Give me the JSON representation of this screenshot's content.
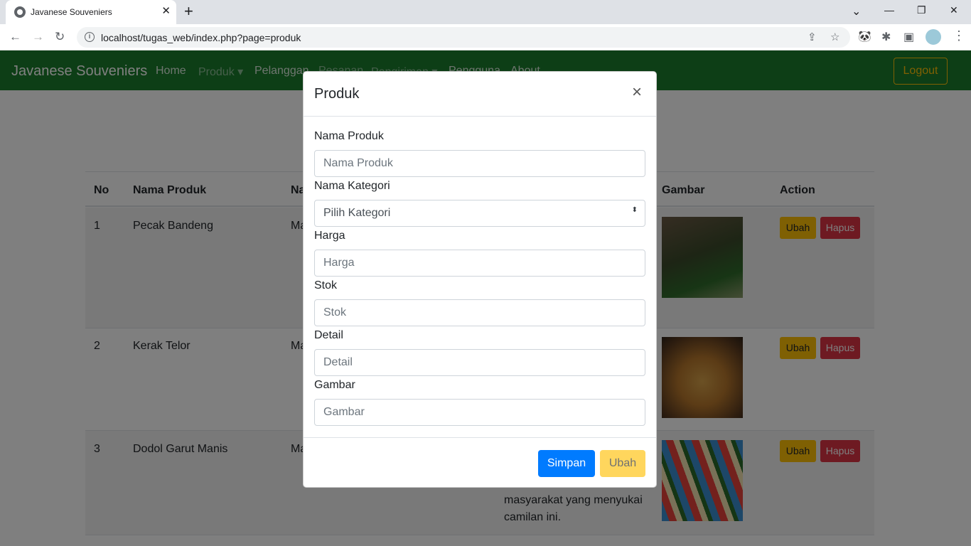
{
  "browser": {
    "tab_title": "Javanese Souveniers",
    "tab_close": "✕",
    "new_tab": "+",
    "url": "localhost/tugas_web/index.php?page=produk",
    "info_glyph": "i",
    "window_controls": {
      "chevron": "⌄",
      "minimize": "—",
      "restore": "❐",
      "close": "✕"
    },
    "nav": {
      "back": "←",
      "forward": "→",
      "reload": "↻"
    },
    "omni_icons": {
      "share": "⇪",
      "star": "☆"
    },
    "extensions": {
      "panda": "🐼",
      "puzzle": "✱",
      "sidepanel": "▣",
      "menu": "⋮"
    }
  },
  "navbar": {
    "brand": "Javanese Souveniers",
    "links": [
      "Home",
      "Produk ▾",
      "Pelanggan",
      "Pesanan",
      "Pengiriman ▾",
      "Pengguna",
      "About"
    ],
    "logout": "Logout"
  },
  "table": {
    "headers": [
      "No",
      "Nama Produk",
      "Na",
      "Gambar",
      "Action"
    ],
    "rows": [
      {
        "no": "1",
        "name": "Pecak Bandeng",
        "kategori": "Ma"
      },
      {
        "no": "2",
        "name": "Kerak Telor",
        "kategori": "Ma"
      },
      {
        "no": "3",
        "name": "Dodol Garut Manis",
        "kategori": "Ma"
      }
    ],
    "desc_lines": [
      "masyarakat yang menyukai",
      "camilan ini."
    ],
    "action_ubah": "Ubah",
    "action_hapus": "Hapus"
  },
  "modal": {
    "title": "Produk",
    "close": "×",
    "fields": {
      "nama_produk": {
        "label": "Nama Produk",
        "placeholder": "Nama Produk"
      },
      "kategori": {
        "label": "Nama Kategori",
        "value": "Pilih Kategori",
        "arrow": "⬍"
      },
      "harga": {
        "label": "Harga",
        "placeholder": "Harga"
      },
      "stok": {
        "label": "Stok",
        "placeholder": "Stok"
      },
      "detail": {
        "label": "Detail",
        "placeholder": "Detail"
      },
      "gambar": {
        "label": "Gambar",
        "placeholder": "Gambar"
      }
    },
    "btn_simpan": "Simpan",
    "btn_ubah": "Ubah"
  },
  "colors": {
    "navbar": "#1b7c2c",
    "primary": "#007bff",
    "warning": "#ffc107",
    "danger": "#dc3545"
  }
}
